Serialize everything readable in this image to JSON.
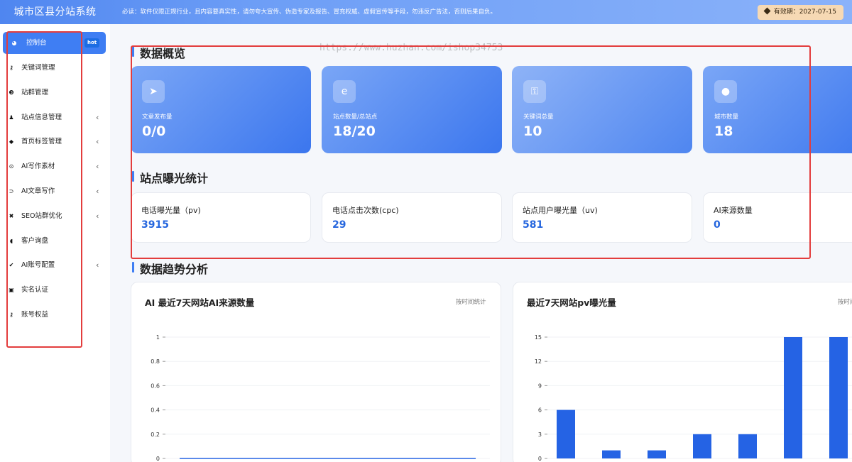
{
  "header": {
    "brand": "城市区县分站系统",
    "notice": "必读：软件仅限正规行业，且内容要真实性，请勿夸大宣传、伪造专家及报告、冒充权威、虚假宣传等手段，勿违反广告法，否则后果自负。",
    "expire": "有效期：2027-07-15"
  },
  "sidebar": {
    "items": [
      {
        "label": "控制台",
        "icon": "dashboard-icon",
        "badge": "hot",
        "active": true
      },
      {
        "label": "关键词管理",
        "icon": "key-icon",
        "arrow": false
      },
      {
        "label": "站群管理",
        "icon": "sites-icon",
        "arrow": false
      },
      {
        "label": "站点信息管理",
        "icon": "info-icon",
        "arrow": true
      },
      {
        "label": "首页标签管理",
        "icon": "tag-icon",
        "arrow": true
      },
      {
        "label": "AI写作素材",
        "icon": "material-icon",
        "arrow": true
      },
      {
        "label": "AI文章写作",
        "icon": "write-icon",
        "arrow": true
      },
      {
        "label": "SEO站群优化",
        "icon": "seo-icon",
        "arrow": true
      },
      {
        "label": "客户询盘",
        "icon": "inquiry-icon",
        "arrow": false
      },
      {
        "label": "AI账号配置",
        "icon": "config-icon",
        "arrow": true
      },
      {
        "label": "实名认证",
        "icon": "id-card-icon",
        "arrow": false
      },
      {
        "label": "账号权益",
        "icon": "rights-icon",
        "arrow": false
      }
    ],
    "chevron": "‹"
  },
  "watermark": "https://www.huzhan.com/ishop34753",
  "overview": {
    "title": "数据概览",
    "cards": [
      {
        "label": "文章发布量",
        "value": "0/0",
        "icon": "paper-plane-icon",
        "glyph": "➤"
      },
      {
        "label": "站点数量/总站点",
        "value": "18/20",
        "icon": "browser-e-icon",
        "glyph": "e"
      },
      {
        "label": "关键词总量",
        "value": "10",
        "icon": "key-icon",
        "glyph": "⚿"
      },
      {
        "label": "城市数量",
        "value": "18",
        "icon": "users-icon",
        "glyph": "●"
      }
    ]
  },
  "exposure": {
    "title": "站点曝光统计",
    "cards": [
      {
        "label": "电话曝光量（pv)",
        "value": "3915"
      },
      {
        "label": "电话点击次数(cpc)",
        "value": "29"
      },
      {
        "label": "站点用户曝光量（uv)",
        "value": "581"
      },
      {
        "label": "AI来源数量",
        "value": "0"
      }
    ]
  },
  "trend": {
    "title": "数据趋势分析",
    "panel1": {
      "title": "AI 最近7天网站AI来源数量",
      "sub": "按时间统计"
    },
    "panel2": {
      "title": "最近7天网站pv曝光量",
      "sub": "按时间统计"
    }
  },
  "chart_data": [
    {
      "type": "line",
      "title": "AI 最近7天网站AI来源数量",
      "ylim": [
        0,
        1
      ],
      "yticks": [
        "1",
        "0.8",
        "0.6",
        "0.4",
        "0.2",
        "0"
      ],
      "series": [
        {
          "values": [
            0,
            0,
            0,
            0,
            0,
            0,
            0
          ]
        }
      ],
      "grid": true
    },
    {
      "type": "bar",
      "title": "最近7天网站pv曝光量",
      "ylim": [
        0,
        15
      ],
      "yticks": [
        "15",
        "12",
        "9",
        "6",
        "3",
        "0"
      ],
      "values": [
        6,
        1,
        1,
        3,
        3,
        15,
        15
      ],
      "color": "#2563e4",
      "grid": true
    }
  ]
}
